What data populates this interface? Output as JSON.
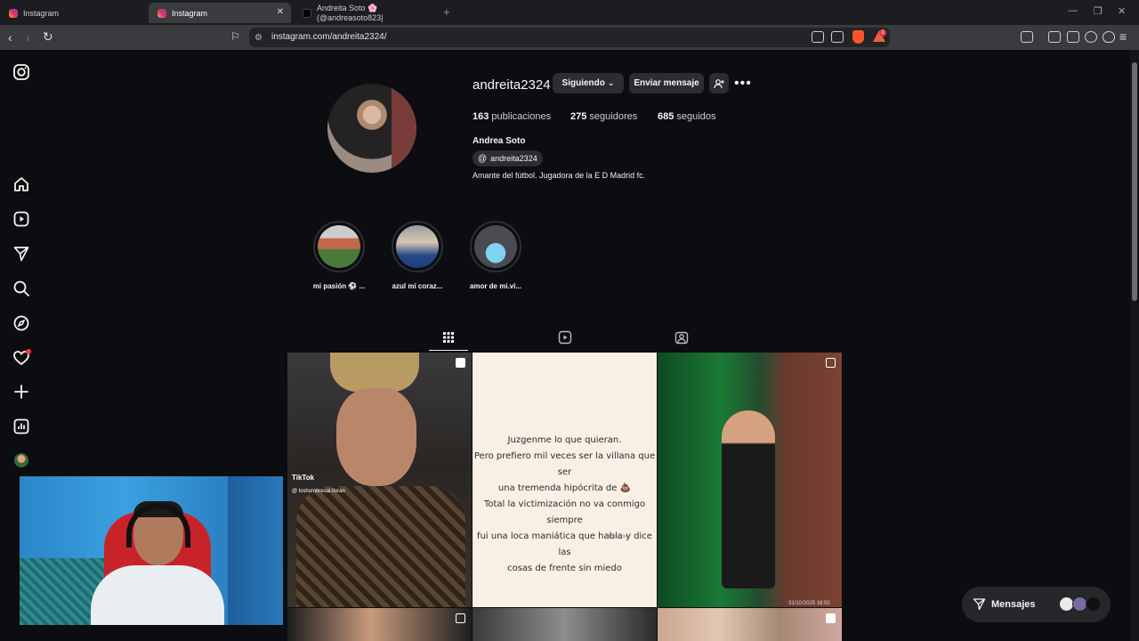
{
  "browser": {
    "tabs": [
      {
        "title": "Instagram"
      },
      {
        "title": "Instagram"
      },
      {
        "title": "Andreita Soto 🌸 (@andreasoto823|"
      }
    ],
    "url": "instagram.com/andreita2324/",
    "brave_badge": "1"
  },
  "profile": {
    "username": "andreita2324",
    "follow_button": "Siguiendo",
    "message_button": "Enviar mensaje",
    "posts_count": "163",
    "posts_label": "publicaciones",
    "followers_count": "275",
    "followers_label": "seguidores",
    "following_count": "685",
    "following_label": "seguidos",
    "full_name": "Andrea Soto",
    "threads_handle": "andreita2324",
    "bio": "Amante del fútbol. Jugadora de la E D Madrid fc."
  },
  "highlights": [
    {
      "label": "mi pasión ⚽ ..."
    },
    {
      "label": "azul mi coraz..."
    },
    {
      "label": "amor de mi.vi..."
    }
  ],
  "posts": {
    "p1_tiktok": "TikTok",
    "p1_tiktok_user": "@ loshombresal.lloran",
    "p2_quote_lines": [
      "Juzgenme lo que quieran.",
      "Pero prefiero mil veces ser la villana que ser",
      "una tremenda hipócrita de 💩",
      "Total la victimización no va conmigo siempre",
      "fui una loca maniática que habla y dice las",
      "cosas de frente sin miedo"
    ],
    "p2_handle": "@hipocritas",
    "p3_date": "31/10/2025 18:50"
  },
  "messages": {
    "label": "Mensajes"
  },
  "colors": {
    "background": "#0b0d10",
    "button": "#2b2d31",
    "notification": "#ff3040"
  }
}
